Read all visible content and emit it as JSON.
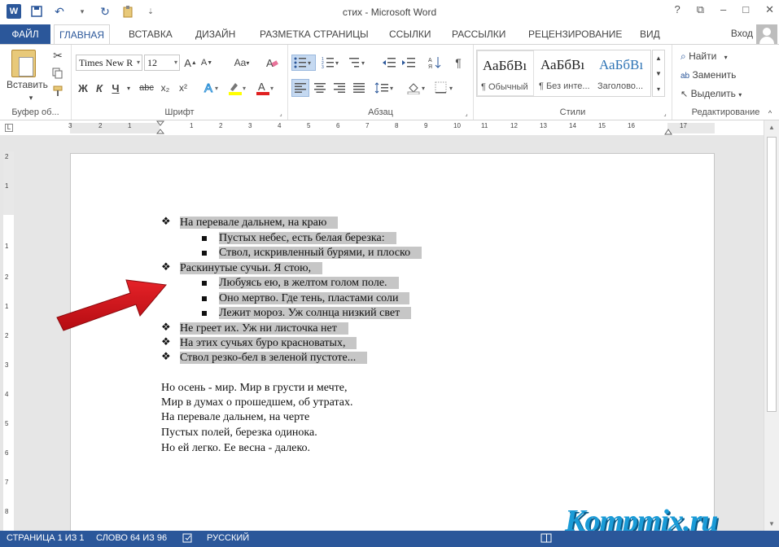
{
  "window": {
    "title": "стих - Microsoft Word",
    "controls": [
      "?",
      "⧉",
      "–",
      "□",
      "✕"
    ]
  },
  "qat": {
    "word_icon": "W",
    "icons": [
      "save-icon",
      "undo-icon",
      "redo-icon",
      "touch-mode-icon",
      "customize-icon"
    ]
  },
  "tabs": {
    "file": "ФАЙЛ",
    "items": [
      "ГЛАВНАЯ",
      "ВСТАВКА",
      "ДИЗАЙН",
      "РАЗМЕТКА СТРАНИЦЫ",
      "ССЫЛКИ",
      "РАССЫЛКИ",
      "РЕЦЕНЗИРОВАНИЕ",
      "ВИД"
    ],
    "active": "ГЛАВНАЯ",
    "login": "Вход"
  },
  "ribbon": {
    "clipboard": {
      "label": "Буфер об...",
      "paste": "Вставить"
    },
    "font": {
      "label": "Шрифт",
      "name": "Times New R",
      "size": "12",
      "bold": "Ж",
      "italic": "К",
      "underline": "Ч",
      "strike": "abc",
      "sub": "x₂",
      "sup": "x²",
      "case": "Aa"
    },
    "paragraph": {
      "label": "Абзац"
    },
    "styles": {
      "label": "Стили",
      "items": [
        {
          "sample": "АаБбВı",
          "name": "¶ Обычный"
        },
        {
          "sample": "АаБбВı",
          "name": "¶ Без инте..."
        },
        {
          "sample": "АаБбВı",
          "name": "Заголово..."
        }
      ]
    },
    "editing": {
      "label": "Редактирование",
      "find": "Найти",
      "replace": "Заменить",
      "select": "Выделить"
    }
  },
  "ruler": {
    "numbers": [
      "3",
      "2",
      "1",
      "1",
      "2",
      "3",
      "4",
      "5",
      "6",
      "7",
      "8",
      "9",
      "10",
      "11",
      "12",
      "13",
      "14",
      "15",
      "16",
      "17"
    ]
  },
  "vruler": {
    "numbers": [
      "2",
      "1",
      "1",
      "2",
      "1",
      "2",
      "3",
      "4",
      "5",
      "6",
      "7",
      "8"
    ]
  },
  "document": {
    "list": [
      {
        "level": 1,
        "text": "На перевале дальнем, на краю"
      },
      {
        "level": 2,
        "text": "Пустых небес, есть белая березка:"
      },
      {
        "level": 2,
        "text": "Ствол, искривленный бурями, и плоско"
      },
      {
        "level": 1,
        "text": "Раскинутые сучьи. Я стою,"
      },
      {
        "level": 2,
        "text": "Любуясь ею, в желтом голом поле."
      },
      {
        "level": 2,
        "text": "Оно мертво. Где тень, пластами соли"
      },
      {
        "level": 2,
        "text": "Лежит мороз. Уж солнца низкий свет"
      },
      {
        "level": 1,
        "text": "Не греет их. Уж ни листочка нет"
      },
      {
        "level": 1,
        "text": "На этих сучьях буро красноватых,"
      },
      {
        "level": 1,
        "text": "Ствол резко-бел в зеленой пустоте..."
      }
    ],
    "stanza": [
      "Но осень - мир. Мир в грусти и мечте,",
      "Мир в думах о прошедшем, об утратах.",
      "На перевале дальнем, на черте",
      "Пустых полей, березка одинока.",
      "Но ей легко. Ее весна - далеко."
    ]
  },
  "status": {
    "page": "СТРАНИЦА 1 ИЗ 1",
    "words": "СЛОВО 64 ИЗ 96",
    "language": "РУССКИЙ"
  },
  "watermark": "Kompmix.ru",
  "colors": {
    "accent": "#2b579a",
    "highlight": "#c6c6c6",
    "arrow": "#d4141b"
  }
}
